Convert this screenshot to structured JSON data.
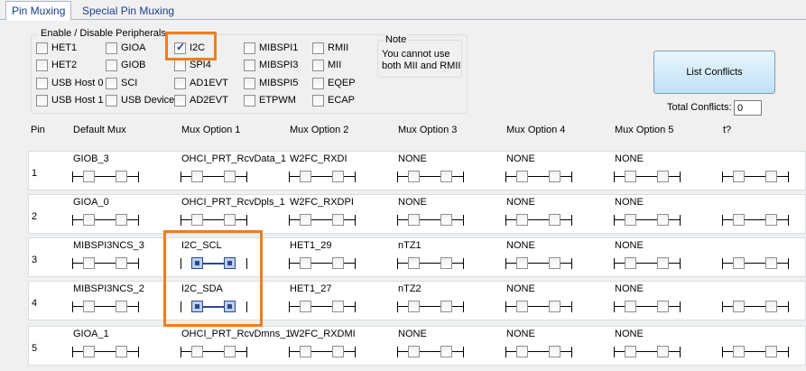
{
  "tabs": [
    "Pin Muxing",
    "Special Pin Muxing"
  ],
  "peripherals": {
    "title": "Enable / Disable Peripherals",
    "items": [
      {
        "label": "HET1",
        "checked": false
      },
      {
        "label": "GIOA",
        "checked": false
      },
      {
        "label": "I2C",
        "checked": true
      },
      {
        "label": "MIBSPI1",
        "checked": false
      },
      {
        "label": "RMII",
        "checked": false
      },
      {
        "label": "HET2",
        "checked": false
      },
      {
        "label": "GIOB",
        "checked": false
      },
      {
        "label": "SPI4",
        "checked": false
      },
      {
        "label": "MIBSPI3",
        "checked": false
      },
      {
        "label": "MII",
        "checked": false
      },
      {
        "label": "USB Host 0",
        "checked": false
      },
      {
        "label": "SCI",
        "checked": false
      },
      {
        "label": "AD1EVT",
        "checked": false
      },
      {
        "label": "MIBSPI5",
        "checked": false
      },
      {
        "label": "EQEP",
        "checked": false
      },
      {
        "label": "USB Host 1",
        "checked": false
      },
      {
        "label": "USB Device",
        "checked": false
      },
      {
        "label": "AD2EVT",
        "checked": false
      },
      {
        "label": "ETPWM",
        "checked": false
      },
      {
        "label": "ECAP",
        "checked": false
      }
    ]
  },
  "note": {
    "title": "Note",
    "lines": [
      "You cannot use",
      "both MII and RMII"
    ]
  },
  "list_conflicts_label": "List Conflicts",
  "total_conflicts_label": "Total Conflicts:",
  "total_conflicts_value": "0",
  "columns": [
    "Pin",
    "Default Mux",
    "Mux Option 1",
    "Mux Option 2",
    "Mux Option 3",
    "Mux Option 4",
    "Mux Option 5",
    "t?"
  ],
  "rows": [
    {
      "pin": "1",
      "options": [
        "GIOB_3",
        "OHCI_PRT_RcvData_1",
        "W2FC_RXDI",
        "NONE",
        "NONE",
        "NONE",
        ""
      ],
      "connected": [
        false,
        false,
        false,
        false,
        false,
        false,
        false
      ]
    },
    {
      "pin": "2",
      "options": [
        "GIOA_0",
        "OHCI_PRT_RcvDpls_1",
        "W2FC_RXDPI",
        "NONE",
        "NONE",
        "NONE",
        ""
      ],
      "connected": [
        false,
        false,
        false,
        false,
        false,
        false,
        false
      ]
    },
    {
      "pin": "3",
      "options": [
        "MIBSPI3NCS_3",
        "I2C_SCL",
        "HET1_29",
        "nTZ1",
        "NONE",
        "NONE",
        ""
      ],
      "connected": [
        false,
        true,
        false,
        false,
        false,
        false,
        false
      ]
    },
    {
      "pin": "4",
      "options": [
        "MIBSPI3NCS_2",
        "I2C_SDA",
        "HET1_27",
        "nTZ2",
        "NONE",
        "NONE",
        ""
      ],
      "connected": [
        false,
        true,
        false,
        false,
        false,
        false,
        false
      ]
    },
    {
      "pin": "5",
      "options": [
        "GIOA_1",
        "OHCI_PRT_RcvDmns_1",
        "W2FC_RXDMI",
        "NONE",
        "NONE",
        "NONE",
        ""
      ],
      "connected": [
        false,
        false,
        false,
        false,
        false,
        false,
        false
      ]
    }
  ],
  "colors": {
    "highlight": "#f07d1d",
    "tab_text": "#1a3d8c",
    "connected_switch": "#2b4a8f"
  }
}
